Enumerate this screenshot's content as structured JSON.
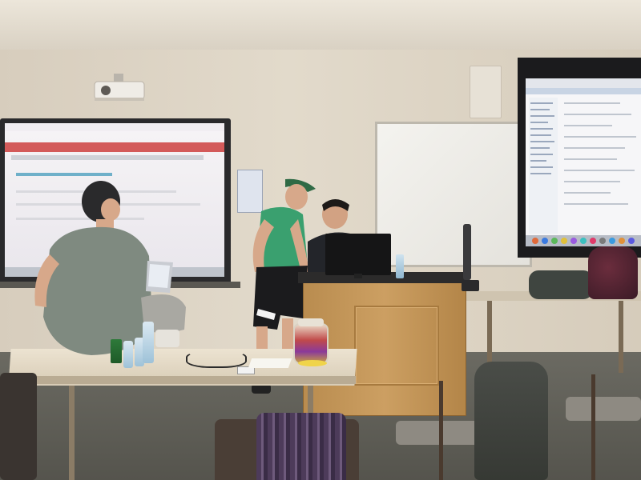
{
  "scene": {
    "colors": {
      "wall": "#dcd2c2",
      "floor": "#5f5e57",
      "podium_wood": "#c49659",
      "table_top": "#e4dac6",
      "screen_dark": "#1b1b1d",
      "shirt_seated": "#7f8a80",
      "shirt_standing": "#3aa06f",
      "cap": "#2f6a45",
      "candy_jar_lid": "#e8e2d6",
      "plate": "#f0d44a",
      "backpack": "#5a2534",
      "plaid_shirt": "#4d3b5a"
    },
    "objects": [
      "projector",
      "smartboard",
      "whiteboard",
      "projection-screen",
      "podium",
      "monitor",
      "candy-jar",
      "water-bottles",
      "laptop",
      "chairs",
      "backpack"
    ]
  }
}
